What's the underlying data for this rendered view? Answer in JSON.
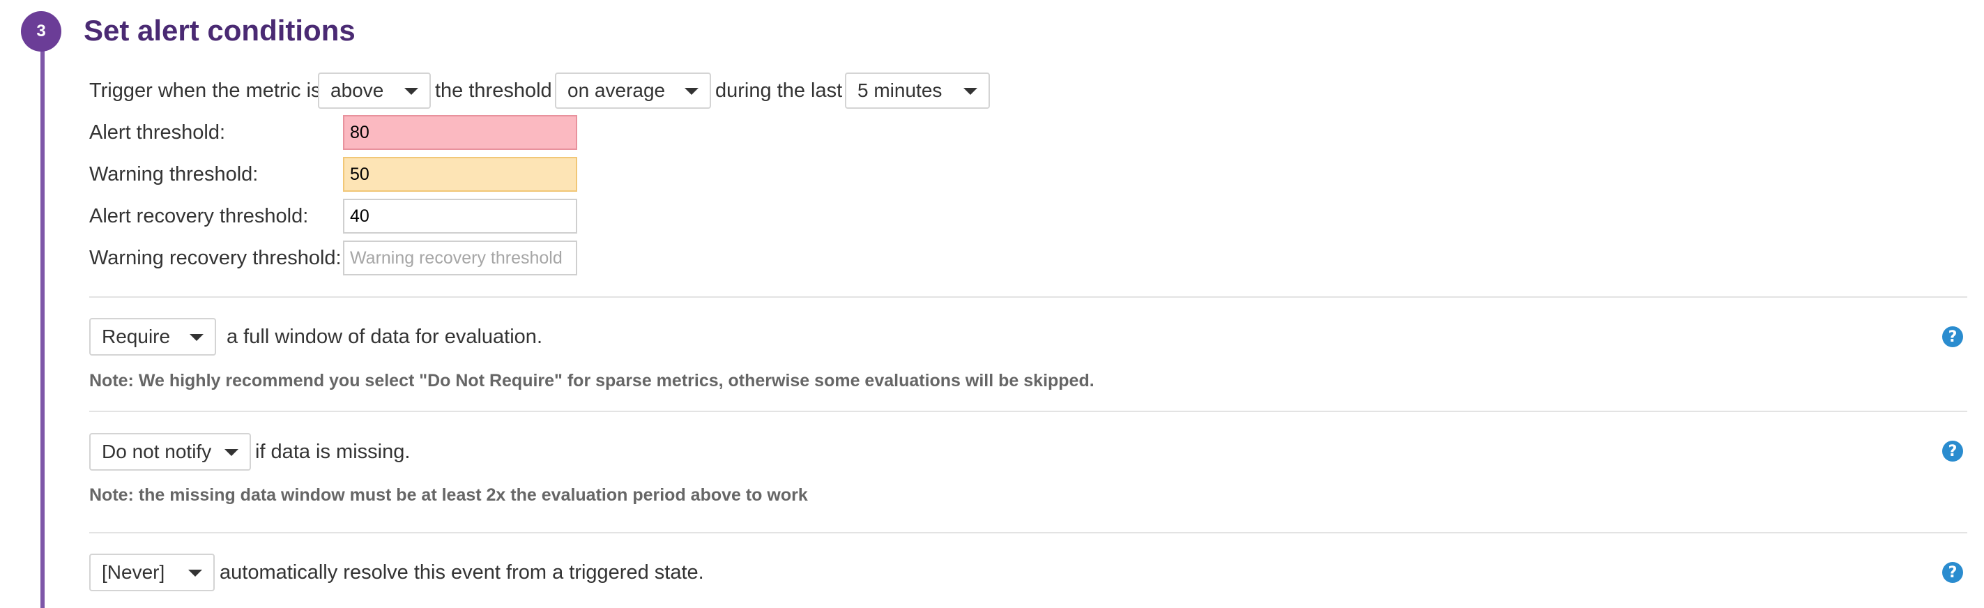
{
  "step": {
    "number": "3",
    "title": "Set alert conditions"
  },
  "trigger": {
    "prefix": "Trigger when the metric is",
    "comparator": "above",
    "mid1": "the threshold",
    "aggregation": "on average",
    "mid2": "during the last",
    "window": "5 minutes"
  },
  "thresholds": {
    "alert_label": "Alert threshold:",
    "alert_value": "80",
    "warning_label": "Warning threshold:",
    "warning_value": "50",
    "alert_recovery_label": "Alert recovery threshold:",
    "alert_recovery_value": "40",
    "warning_recovery_label": "Warning recovery threshold:",
    "warning_recovery_value": "",
    "warning_recovery_placeholder": "Warning recovery threshold"
  },
  "full_window": {
    "select": "Require",
    "text": "a full window of data for evaluation.",
    "note": "Note: We highly recommend you select \"Do Not Require\" for sparse metrics, otherwise some evaluations will be skipped."
  },
  "missing_data": {
    "select": "Do not notify",
    "text": "if data is missing.",
    "note": "Note: the missing data window must be at least 2x the evaluation period above to work"
  },
  "auto_resolve": {
    "select": "[Never]",
    "text": "automatically resolve this event from a triggered state."
  },
  "help_glyph": "?",
  "colors": {
    "accent_purple": "#6b3d97",
    "alert_bg": "#fbb9c1",
    "warning_bg": "#fde4b5",
    "help_blue": "#2a8ccf"
  }
}
